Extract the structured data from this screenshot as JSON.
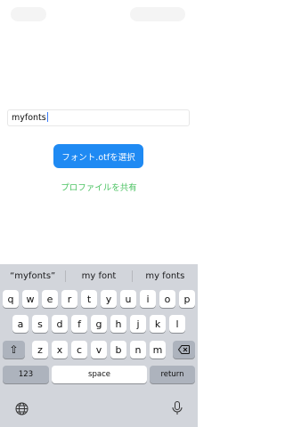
{
  "text_field": {
    "value": "myfonts"
  },
  "primary_button": {
    "label": "フォント.otfを選択"
  },
  "share_profile_link": {
    "label": "プロファイルを共有"
  },
  "keyboard": {
    "suggestions": [
      "“myfonts”",
      "my font",
      "my fonts"
    ],
    "row1": [
      "q",
      "w",
      "e",
      "r",
      "t",
      "y",
      "u",
      "i",
      "o",
      "p"
    ],
    "row2": [
      "a",
      "s",
      "d",
      "f",
      "g",
      "h",
      "j",
      "k",
      "l"
    ],
    "row3": [
      "z",
      "x",
      "c",
      "v",
      "b",
      "n",
      "m"
    ],
    "numbers_label": "123",
    "space_label": "space",
    "return_label": "return"
  },
  "colors": {
    "primary_button": "#1f8af3",
    "link": "#4cc363",
    "keyboard_bg": "#d2d5db"
  }
}
